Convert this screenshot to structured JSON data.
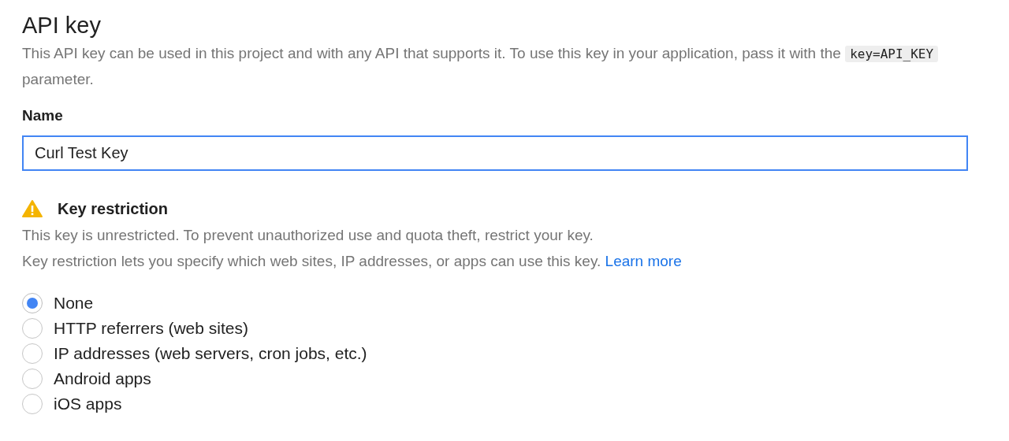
{
  "title": "API key",
  "description": {
    "text": "This API key can be used in this project and with any API that supports it. To use this key in your application, pass it with the",
    "code": "key=API_KEY",
    "after": "parameter."
  },
  "name_field": {
    "label": "Name",
    "value": "Curl Test Key",
    "focused": true
  },
  "restriction": {
    "heading": "Key restriction",
    "warning": true,
    "lines": [
      {
        "text": "This key is unrestricted. To prevent unauthorized use and quota theft, restrict your key."
      },
      {
        "text": "Key restriction lets you specify which web sites, IP addresses, or apps can use this key.",
        "link": "Learn more"
      }
    ],
    "options": [
      {
        "label": "None",
        "selected": true
      },
      {
        "label": "HTTP referrers (web sites)",
        "selected": false
      },
      {
        "label": "IP addresses (web servers, cron jobs, etc.)",
        "selected": false
      },
      {
        "label": "Android apps",
        "selected": false
      },
      {
        "label": "iOS apps",
        "selected": false
      }
    ]
  }
}
